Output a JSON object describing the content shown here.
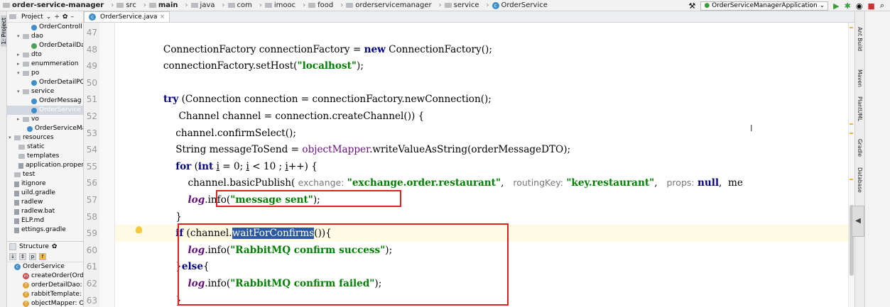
{
  "breadcrumbs": [
    "order-service-manager",
    "src",
    "main",
    "java",
    "com",
    "imooc",
    "food",
    "orderservicemanager",
    "service",
    "OrderService"
  ],
  "run_config": "OrderServiceManagerApplication",
  "project_panel": {
    "header": "Project",
    "items": [
      {
        "label": "OrderControll",
        "indent": 4,
        "icon": "cl"
      },
      {
        "label": "dao",
        "indent": 2,
        "icon": "pkg",
        "arrow": "▾"
      },
      {
        "label": "OrderDetailDa",
        "indent": 4,
        "icon": "cli"
      },
      {
        "label": "dto",
        "indent": 2,
        "icon": "pkg",
        "arrow": "▸"
      },
      {
        "label": "enummeration",
        "indent": 2,
        "icon": "pkg",
        "arrow": "▸"
      },
      {
        "label": "po",
        "indent": 2,
        "icon": "pkg",
        "arrow": "▾"
      },
      {
        "label": "OrderDetailPO",
        "indent": 4,
        "icon": "cl"
      },
      {
        "label": "service",
        "indent": 2,
        "icon": "pkg",
        "arrow": "▾"
      },
      {
        "label": "OrderMessag",
        "indent": 4,
        "icon": "cl"
      },
      {
        "label": "OrderService",
        "indent": 4,
        "icon": "cl",
        "selected": true
      },
      {
        "label": "vo",
        "indent": 2,
        "icon": "pkg",
        "arrow": "▸"
      },
      {
        "label": "OrderServiceMan",
        "indent": 3,
        "icon": "cl"
      },
      {
        "label": "resources",
        "indent": 0,
        "icon": "pkg",
        "arrow": "▾"
      },
      {
        "label": "static",
        "indent": 1,
        "icon": "pkg"
      },
      {
        "label": "templates",
        "indent": 1,
        "icon": "pkg"
      },
      {
        "label": "application.propertie",
        "indent": 1,
        "icon": "file"
      },
      {
        "label": "test",
        "indent": 0,
        "icon": "pkg"
      },
      {
        "label": "itignore",
        "indent": 0,
        "icon": "file"
      },
      {
        "label": "uild.gradle",
        "indent": 0,
        "icon": "file"
      },
      {
        "label": "radlew",
        "indent": 0,
        "icon": "file"
      },
      {
        "label": "radlew.bat",
        "indent": 0,
        "icon": "file"
      },
      {
        "label": "ELP.md",
        "indent": 0,
        "icon": "file"
      },
      {
        "label": "ettings.gradle",
        "indent": 0,
        "icon": "file"
      }
    ]
  },
  "structure_panel": {
    "header": "Structure",
    "items": [
      {
        "label": "OrderService",
        "badge": "c",
        "indent": 0
      },
      {
        "label": "createOrder(Ord",
        "badge": "m",
        "indent": 2
      },
      {
        "label": "orderDetailDao:",
        "badge": "f",
        "indent": 2
      },
      {
        "label": "rabbitTemplate:",
        "badge": "f",
        "indent": 2
      },
      {
        "label": "objectMapper: O",
        "badge": "f",
        "indent": 2
      }
    ]
  },
  "editor_tab": "OrderService.java",
  "code_lines": [
    {
      "num": "47",
      "html": ""
    },
    {
      "num": "48",
      "html": "      ConnectionFactory connectionFactory = <span class=\"kw\">new</span> ConnectionFactory();"
    },
    {
      "num": "49",
      "html": "      connectionFactory.setHost(<span class=\"str\">\"localhost\"</span>);"
    },
    {
      "num": "50",
      "html": ""
    },
    {
      "num": "51",
      "html": "      <span class=\"kw\">try</span> (Connection connection = connectionFactory.newConnection();"
    },
    {
      "num": "52",
      "html": "           Channel channel = connection.createChannel()) {"
    },
    {
      "num": "53",
      "html": "          channel.confirmSelect();"
    },
    {
      "num": "54",
      "html": "          String messageToSend = <span class=\"fld2\">objectMapper</span>.writeValueAsString(orderMessageDTO);"
    },
    {
      "num": "55",
      "html": "          <span class=\"kw\">for</span> (<span class=\"kw\">int</span> <span class=\"und\">i</span> = 0; <span class=\"und\">i</span> &lt; 10 ; <span class=\"und\">i</span>++) {"
    },
    {
      "num": "56",
      "html": "              channel.basicPublish( <span class=\"hint\">exchange:</span> <span class=\"str\">\"exchange.order.restaurant\"</span>,   <span class=\"hint\">routingKey:</span> <span class=\"str\">\"key.restaurant\"</span>,   <span class=\"hint\">props:</span> <span class=\"kw\">null</span>,  me"
    },
    {
      "num": "57",
      "html": "              <span class=\"lg\">log</span>.info(<span class=\"str\">\"message sent\"</span>);"
    },
    {
      "num": "58",
      "html": "          }"
    },
    {
      "num": "59",
      "html": "          <span class=\"kw\">if</span> (channel.<span class=\"sel\">waitForConfirms</span>()){",
      "hl": true
    },
    {
      "num": "60",
      "html": "              <span class=\"lg\">log</span>.info(<span class=\"str\">\"RabbitMQ confirm success\"</span>);"
    },
    {
      "num": "61",
      "html": "          }<span class=\"kw\">else</span>{"
    },
    {
      "num": "62",
      "html": "              <span class=\"lg\">log</span>.info(<span class=\"str\">\"RabbitMQ confirm failed\"</span>);"
    },
    {
      "num": "63",
      "html": "          }"
    }
  ],
  "right_tools": [
    "Ant Build",
    "Maven",
    "PlantUML",
    "Gradle",
    "Database"
  ],
  "colors": {
    "keyword": "#000080",
    "string": "#008000",
    "field": "#660e7a",
    "annotation_box": "#dd2222",
    "selection": "#2c5aa0"
  }
}
